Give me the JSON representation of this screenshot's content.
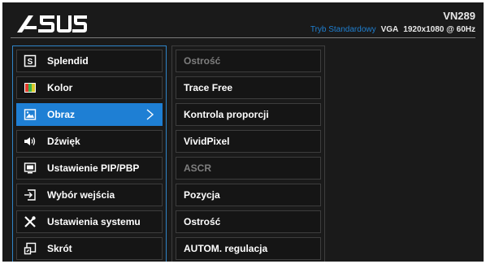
{
  "header": {
    "logo_text": "/ISUS",
    "model": "VN289",
    "mode": "Tryb Standardowy",
    "input": "VGA",
    "resolution": "1920x1080 @ 60Hz"
  },
  "colors": {
    "accent": "#1e7fd4",
    "background": "#1a1a1a",
    "disabled_text": "#7e7e7e"
  },
  "menu": {
    "items": [
      {
        "label": "Splendid",
        "icon": "splendid-s-icon",
        "active": false
      },
      {
        "label": "Kolor",
        "icon": "color-palette-icon",
        "active": false
      },
      {
        "label": "Obraz",
        "icon": "image-icon",
        "active": true
      },
      {
        "label": "Dźwięk",
        "icon": "speaker-icon",
        "active": false
      },
      {
        "label": "Ustawienie PIP/PBP",
        "icon": "pip-monitor-icon",
        "active": false
      },
      {
        "label": "Wybór wejścia",
        "icon": "input-select-icon",
        "active": false
      },
      {
        "label": "Ustawienia systemu",
        "icon": "tools-icon",
        "active": false
      },
      {
        "label": "Skrót",
        "icon": "shortcut-icon",
        "active": false
      }
    ]
  },
  "submenu": {
    "items": [
      {
        "label": "Ostrość",
        "enabled": false
      },
      {
        "label": "Trace Free",
        "enabled": true
      },
      {
        "label": "Kontrola proporcji",
        "enabled": true
      },
      {
        "label": "VividPixel",
        "enabled": true
      },
      {
        "label": "ASCR",
        "enabled": false
      },
      {
        "label": "Pozycja",
        "enabled": true
      },
      {
        "label": "Ostrość",
        "enabled": true
      },
      {
        "label": "AUTOM. regulacja",
        "enabled": true
      }
    ]
  }
}
